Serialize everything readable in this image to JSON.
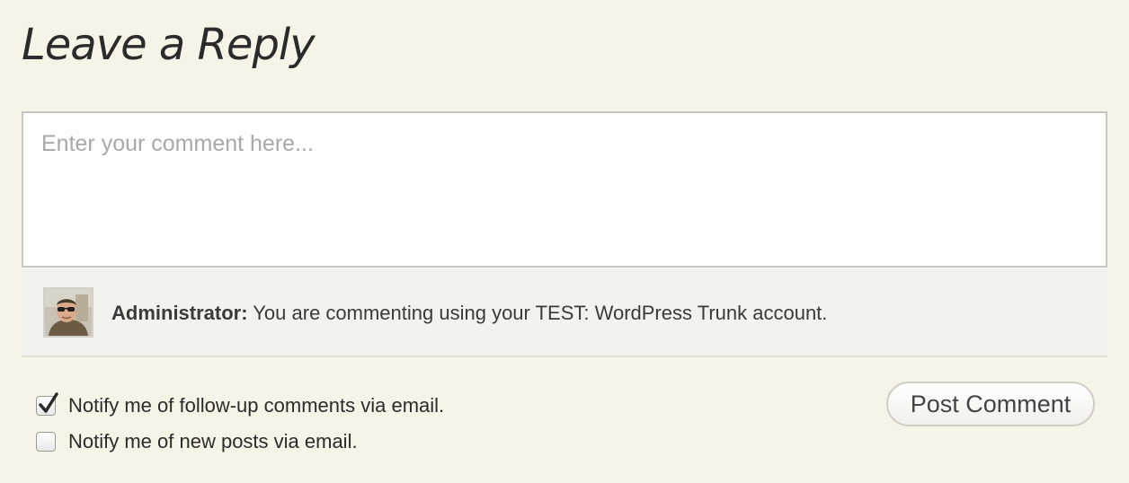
{
  "heading": {
    "title": "Leave a Reply"
  },
  "comment": {
    "placeholder": "Enter your comment here...",
    "value": ""
  },
  "identity": {
    "name": "Administrator:",
    "message": " You are commenting using your TEST: WordPress Trunk account."
  },
  "options": {
    "notify_followup": {
      "label": "Notify me of follow-up comments via email.",
      "checked": true
    },
    "notify_posts": {
      "label": "Notify me of new posts via email.",
      "checked": false
    }
  },
  "actions": {
    "post_label": "Post Comment"
  },
  "colors": {
    "background": "#f6f3e7",
    "identity_bar": "#f4f2ec",
    "text": "#333333",
    "placeholder": "#a9a9a9"
  },
  "icons": {
    "checkmark": "check-icon",
    "avatar": "user-avatar"
  }
}
